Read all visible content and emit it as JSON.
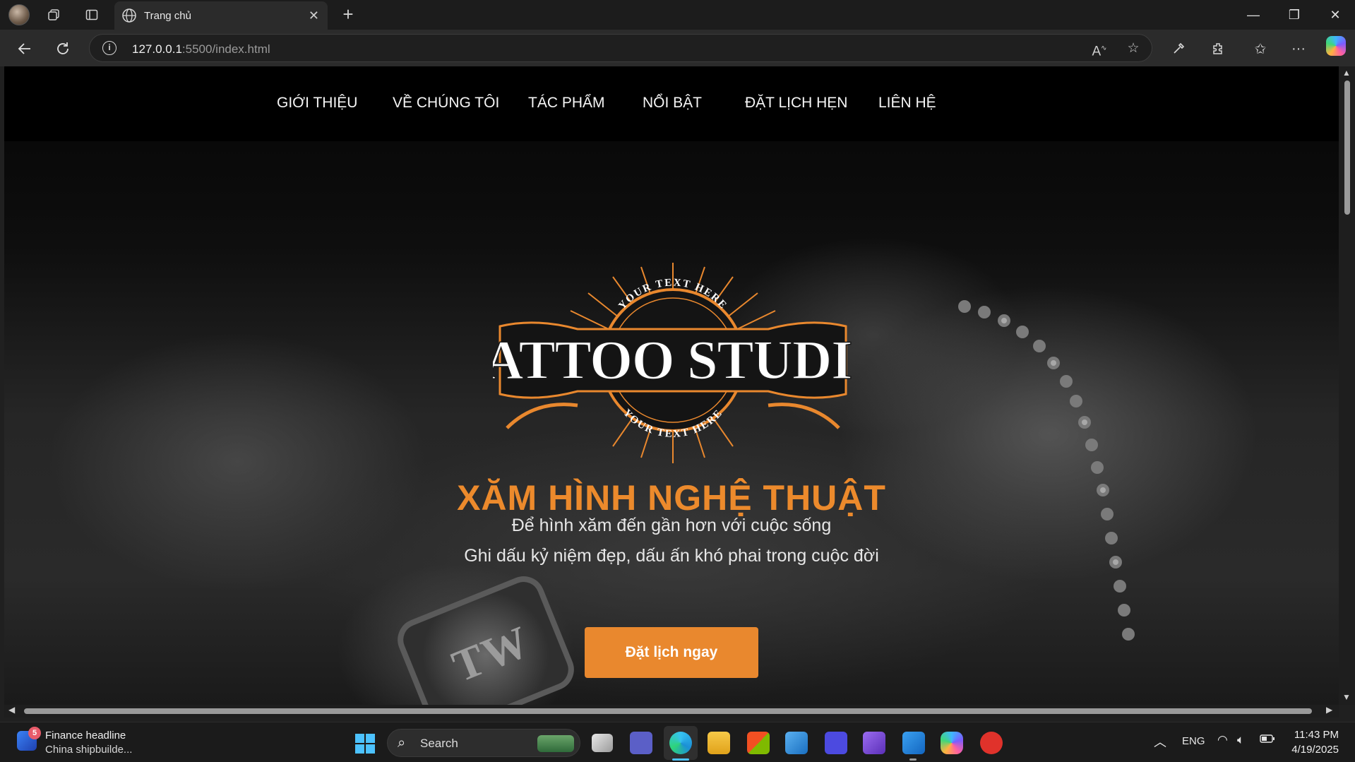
{
  "browser": {
    "tab_title": "Trang chủ",
    "url_host": "127.0.0.1",
    "url_rest": ":5500/index.html",
    "icons": [
      "workspaces-icon",
      "vertical-tabs-icon",
      "globe-icon",
      "close-icon",
      "new-tab-icon",
      "minimize-icon",
      "restore-icon",
      "close-window-icon",
      "back-icon",
      "refresh-icon",
      "info-icon",
      "read-aloud-icon",
      "favorite-star-icon",
      "eyedropper-icon",
      "extensions-icon",
      "favorites-icon",
      "more-icon",
      "copilot-icon"
    ]
  },
  "site": {
    "nav": [
      {
        "label": "GIỚI THIỆU"
      },
      {
        "label": "VỀ CHÚNG TÔI"
      },
      {
        "label": "TÁC PHẨM"
      },
      {
        "label": "NỔI BẬT"
      },
      {
        "label": "ĐẶT LỊCH HẸN"
      },
      {
        "label": "LIÊN HỆ"
      }
    ],
    "logo": {
      "main": "TATTOO STUDIO",
      "arc_top": "YOUR TEXT HERE",
      "arc_bottom": "YOUR TEXT HERE"
    },
    "ring_text": "TW",
    "hero_title": "XĂM HÌNH NGHỆ THUẬT",
    "hero_line1": "Để hình xăm đến gần hơn với cuộc sống",
    "hero_line2": "Ghi dấu kỷ niệm đẹp, dấu ấn khó phai trong cuộc đời",
    "cta_label": "Đặt lịch ngay",
    "colors": {
      "accent": "#ec8a2c",
      "button": "#e9882e",
      "nav_bg": "#000000"
    }
  },
  "taskbar": {
    "widget_badge": "5",
    "news_title": "Finance headline",
    "news_sub": "China shipbuilde...",
    "search_label": "Search",
    "lang": "ENG",
    "time": "11:43 PM",
    "date": "4/19/2025"
  }
}
